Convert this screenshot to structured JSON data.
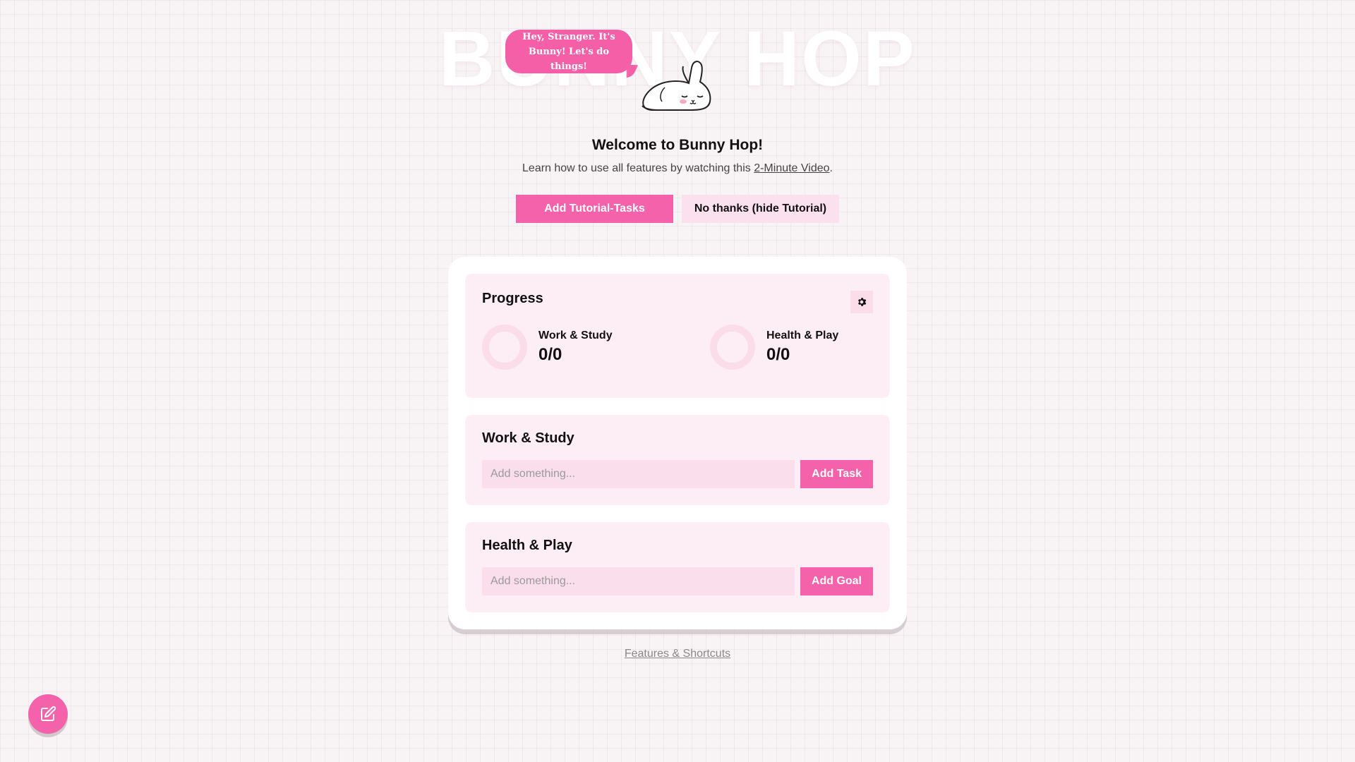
{
  "app": {
    "title": "BUNNY HOP",
    "speech_bubble": "Hey, Stranger. It's Bunny! Let's do things!"
  },
  "welcome": {
    "title": "Welcome to Bunny Hop!",
    "text_before": "Learn how to use all features by watching this ",
    "link_label": "2-Minute Video",
    "text_after": ".",
    "add_tutorial_button": "Add Tutorial-Tasks",
    "hide_tutorial_button": "No thanks (hide Tutorial)"
  },
  "progress": {
    "title": "Progress",
    "settings_icon": "gear-icon",
    "items": [
      {
        "label": "Work & Study",
        "count": "0/0",
        "fraction": 0
      },
      {
        "label": "Health & Play",
        "count": "0/0",
        "fraction": 0
      }
    ]
  },
  "work": {
    "title": "Work & Study",
    "placeholder": "Add something...",
    "button": "Add Task"
  },
  "health": {
    "title": "Health & Play",
    "placeholder": "Add something...",
    "button": "Add Goal"
  },
  "footer": {
    "link": "Features & Shortcuts"
  },
  "fab": {
    "icon": "edit-icon"
  },
  "colors": {
    "accent": "#f462ac",
    "panel": "#fdeef5",
    "light_pink": "#fbdde9"
  }
}
